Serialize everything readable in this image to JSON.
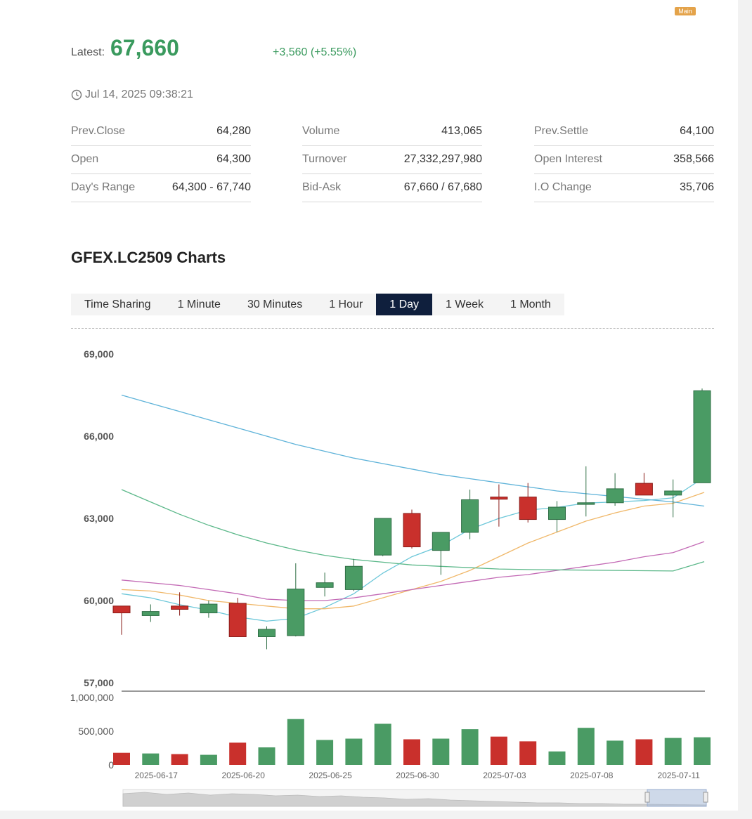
{
  "header": {
    "badge": "Main",
    "latest_label": "Latest:",
    "latest_value": "67,660",
    "change": "+3,560 (+5.55%)",
    "timestamp": "Jul 14, 2025 09:38:21"
  },
  "stats": [
    [
      {
        "label": "Prev.Close",
        "value": "64,280"
      },
      {
        "label": "Open",
        "value": "64,300"
      },
      {
        "label": "Day's Range",
        "value": "64,300 - 67,740"
      }
    ],
    [
      {
        "label": "Volume",
        "value": "413,065"
      },
      {
        "label": "Turnover",
        "value": "27,332,297,980"
      },
      {
        "label": "Bid-Ask",
        "value": "67,660 / 67,680"
      }
    ],
    [
      {
        "label": "Prev.Settle",
        "value": "64,100"
      },
      {
        "label": "Open Interest",
        "value": "358,566"
      },
      {
        "label": "I.O Change",
        "value": "35,706"
      }
    ]
  ],
  "chart_title": "GFEX.LC2509 Charts",
  "tabs": [
    {
      "label": "Time Sharing",
      "active": false
    },
    {
      "label": "1 Minute",
      "active": false
    },
    {
      "label": "30 Minutes",
      "active": false
    },
    {
      "label": "1 Hour",
      "active": false
    },
    {
      "label": "1 Day",
      "active": true
    },
    {
      "label": "1 Week",
      "active": false
    },
    {
      "label": "1 Month",
      "active": false
    }
  ],
  "colors": {
    "up": "#4a9b64",
    "down": "#c9302c",
    "ma_blue": "#5fb3d9",
    "ma_green": "#5cb88a",
    "ma_purple": "#c36ab5",
    "ma_orange": "#f0b86a",
    "ma_cyan": "#6cc7d9",
    "accent_green": "#3a9a5e",
    "active_tab": "#0f1f3d"
  },
  "chart_data": {
    "type": "candlestick",
    "x_tick_labels": [
      "2025-06-17",
      "2025-06-20",
      "2025-06-25",
      "2025-06-30",
      "2025-07-03",
      "2025-07-08",
      "2025-07-11"
    ],
    "x_tick_index": [
      1,
      4,
      7,
      10,
      13,
      16,
      19
    ],
    "price_axis": {
      "ticks": [
        57000,
        60000,
        63000,
        66000,
        69000
      ],
      "tick_labels": [
        "57,000",
        "60,000",
        "63,000",
        "66,000",
        "69,000"
      ],
      "ylim": [
        57000,
        69000
      ]
    },
    "volume_axis": {
      "ticks": [
        0,
        500000,
        1000000
      ],
      "tick_labels": [
        "0",
        "500,000",
        "1,000,000"
      ],
      "ylim": [
        0,
        1000000
      ]
    },
    "candles": [
      {
        "open": 59800,
        "high": 59800,
        "low": 58750,
        "close": 59550
      },
      {
        "open": 59450,
        "high": 59860,
        "low": 59220,
        "close": 59600
      },
      {
        "open": 59800,
        "high": 60300,
        "low": 59450,
        "close": 59680
      },
      {
        "open": 59550,
        "high": 60000,
        "low": 59370,
        "close": 59870
      },
      {
        "open": 59900,
        "high": 60100,
        "low": 58670,
        "close": 58680
      },
      {
        "open": 58680,
        "high": 59060,
        "low": 58220,
        "close": 58950
      },
      {
        "open": 58720,
        "high": 61360,
        "low": 58690,
        "close": 60420
      },
      {
        "open": 60480,
        "high": 61020,
        "low": 60150,
        "close": 60650
      },
      {
        "open": 60400,
        "high": 61520,
        "low": 60350,
        "close": 61250
      },
      {
        "open": 61660,
        "high": 63000,
        "low": 61620,
        "close": 63000
      },
      {
        "open": 63180,
        "high": 63320,
        "low": 61900,
        "close": 61960
      },
      {
        "open": 61830,
        "high": 62480,
        "low": 60940,
        "close": 62490
      },
      {
        "open": 62490,
        "high": 64050,
        "low": 62240,
        "close": 63680
      },
      {
        "open": 63780,
        "high": 64240,
        "low": 62700,
        "close": 63700
      },
      {
        "open": 63780,
        "high": 64290,
        "low": 62850,
        "close": 62960
      },
      {
        "open": 62960,
        "high": 63630,
        "low": 62500,
        "close": 63410
      },
      {
        "open": 63510,
        "high": 64900,
        "low": 63070,
        "close": 63570
      },
      {
        "open": 63570,
        "high": 64650,
        "low": 63460,
        "close": 64080
      },
      {
        "open": 64280,
        "high": 64660,
        "low": 63850,
        "close": 63850
      },
      {
        "open": 63850,
        "high": 64420,
        "low": 63040,
        "close": 64000
      },
      {
        "open": 64300,
        "high": 67740,
        "low": 64300,
        "close": 67660
      }
    ],
    "volumes": [
      180000,
      170000,
      160000,
      150000,
      330000,
      260000,
      680000,
      370000,
      390000,
      610000,
      380000,
      390000,
      530000,
      420000,
      350000,
      200000,
      550000,
      360000,
      380000,
      400000,
      410000
    ],
    "ma_lines": [
      {
        "color_key": "ma_cyan",
        "values": [
          60250,
          60100,
          59850,
          59650,
          59400,
          59250,
          59350,
          59750,
          60250,
          61000,
          61600,
          62000,
          62600,
          63000,
          63300,
          63400,
          63560,
          63600,
          63650,
          63750,
          64500
        ]
      },
      {
        "color_key": "ma_orange",
        "values": [
          60400,
          60350,
          60200,
          60000,
          59900,
          59800,
          59700,
          59700,
          59800,
          60100,
          60400,
          60700,
          61100,
          61600,
          62100,
          62500,
          62900,
          63200,
          63450,
          63550,
          63950
        ]
      },
      {
        "color_key": "ma_purple",
        "values": [
          60750,
          60650,
          60550,
          60400,
          60250,
          60050,
          60000,
          60000,
          60100,
          60250,
          60400,
          60550,
          60700,
          60850,
          60950,
          61100,
          61250,
          61400,
          61600,
          61750,
          62150
        ]
      },
      {
        "color_key": "ma_green",
        "values": [
          64050,
          63600,
          63150,
          62750,
          62400,
          62100,
          61850,
          61650,
          61500,
          61400,
          61300,
          61250,
          61200,
          61150,
          61130,
          61120,
          61110,
          61100,
          61090,
          61080,
          61420
        ]
      },
      {
        "color_key": "ma_blue",
        "values": [
          67500,
          67200,
          66900,
          66600,
          66300,
          66000,
          65700,
          65450,
          65200,
          65000,
          64800,
          64600,
          64450,
          64300,
          64150,
          64000,
          63900,
          63800,
          63700,
          63600,
          63450
        ]
      }
    ]
  }
}
